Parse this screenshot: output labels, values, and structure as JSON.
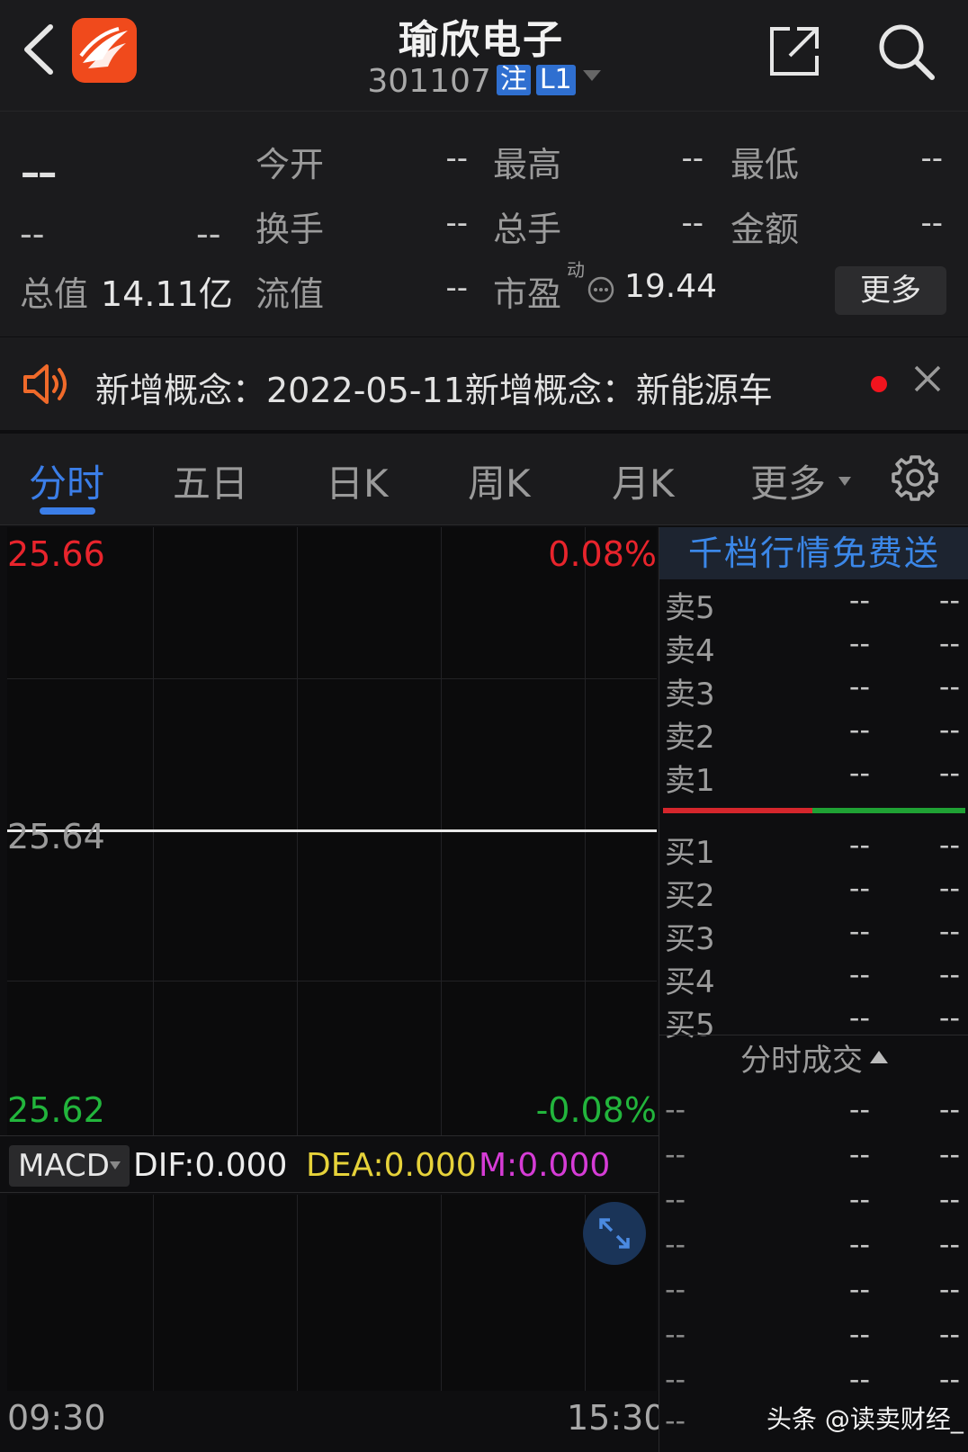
{
  "header": {
    "title": "瑜欣电子",
    "code": "301107",
    "tag_note": "注",
    "tag_level": "L1"
  },
  "quote": {
    "price": "--",
    "change": "--",
    "change_pct": "--",
    "rows": [
      [
        {
          "label": "今开",
          "value": "--"
        },
        {
          "label": "最高",
          "value": "--"
        },
        {
          "label": "最低",
          "value": "--"
        }
      ],
      [
        {
          "label": "换手",
          "value": "--"
        },
        {
          "label": "总手",
          "value": "--"
        },
        {
          "label": "金额",
          "value": "--"
        }
      ]
    ],
    "total_cap_label": "总值",
    "total_cap_value": "14.11亿",
    "float_cap_label": "流值",
    "float_cap_value": "--",
    "pe_label": "市盈",
    "pe_sup": "动",
    "pe_value": "19.44",
    "more_label": "更多"
  },
  "notice": {
    "text": "新增概念：2022-05-11新增概念：新能源车"
  },
  "tabs": [
    "分时",
    "五日",
    "日K",
    "周K",
    "月K",
    "更多"
  ],
  "active_tab": "分时",
  "chart": {
    "y_top": "25.66",
    "y_mid": "25.64",
    "y_bottom": "25.62",
    "pct_top": "0.08%",
    "pct_bottom": "-0.08%",
    "time_start": "09:30",
    "time_end": "15:30",
    "colors": {
      "up": "#e8242c",
      "down": "#22b53c",
      "line": "#e8e8e8"
    }
  },
  "macd": {
    "name": "MACD",
    "dif": "DIF:0.000",
    "dea": "DEA:0.000",
    "m": "M:0.000"
  },
  "order_book": {
    "promo": "千档行情免费送",
    "sell": [
      {
        "label": "卖5",
        "price": "--",
        "volume": "--"
      },
      {
        "label": "卖4",
        "price": "--",
        "volume": "--"
      },
      {
        "label": "卖3",
        "price": "--",
        "volume": "--"
      },
      {
        "label": "卖2",
        "price": "--",
        "volume": "--"
      },
      {
        "label": "卖1",
        "price": "--",
        "volume": "--"
      }
    ],
    "buy": [
      {
        "label": "买1",
        "price": "--",
        "volume": "--"
      },
      {
        "label": "买2",
        "price": "--",
        "volume": "--"
      },
      {
        "label": "买3",
        "price": "--",
        "volume": "--"
      },
      {
        "label": "买4",
        "price": "--",
        "volume": "--"
      },
      {
        "label": "买5",
        "price": "--",
        "volume": "--"
      }
    ]
  },
  "trades": {
    "title": "分时成交",
    "rows": [
      {
        "time": "--",
        "price": "--",
        "volume": "--"
      },
      {
        "time": "--",
        "price": "--",
        "volume": "--"
      },
      {
        "time": "--",
        "price": "--",
        "volume": "--"
      },
      {
        "time": "--",
        "price": "--",
        "volume": "--"
      },
      {
        "time": "--",
        "price": "--",
        "volume": "--"
      },
      {
        "time": "--",
        "price": "--",
        "volume": "--"
      },
      {
        "time": "--",
        "price": "--",
        "volume": "--"
      },
      {
        "time": "--",
        "price": "--",
        "volume": "--"
      }
    ]
  },
  "watermark": "头条 @读卖财经_"
}
